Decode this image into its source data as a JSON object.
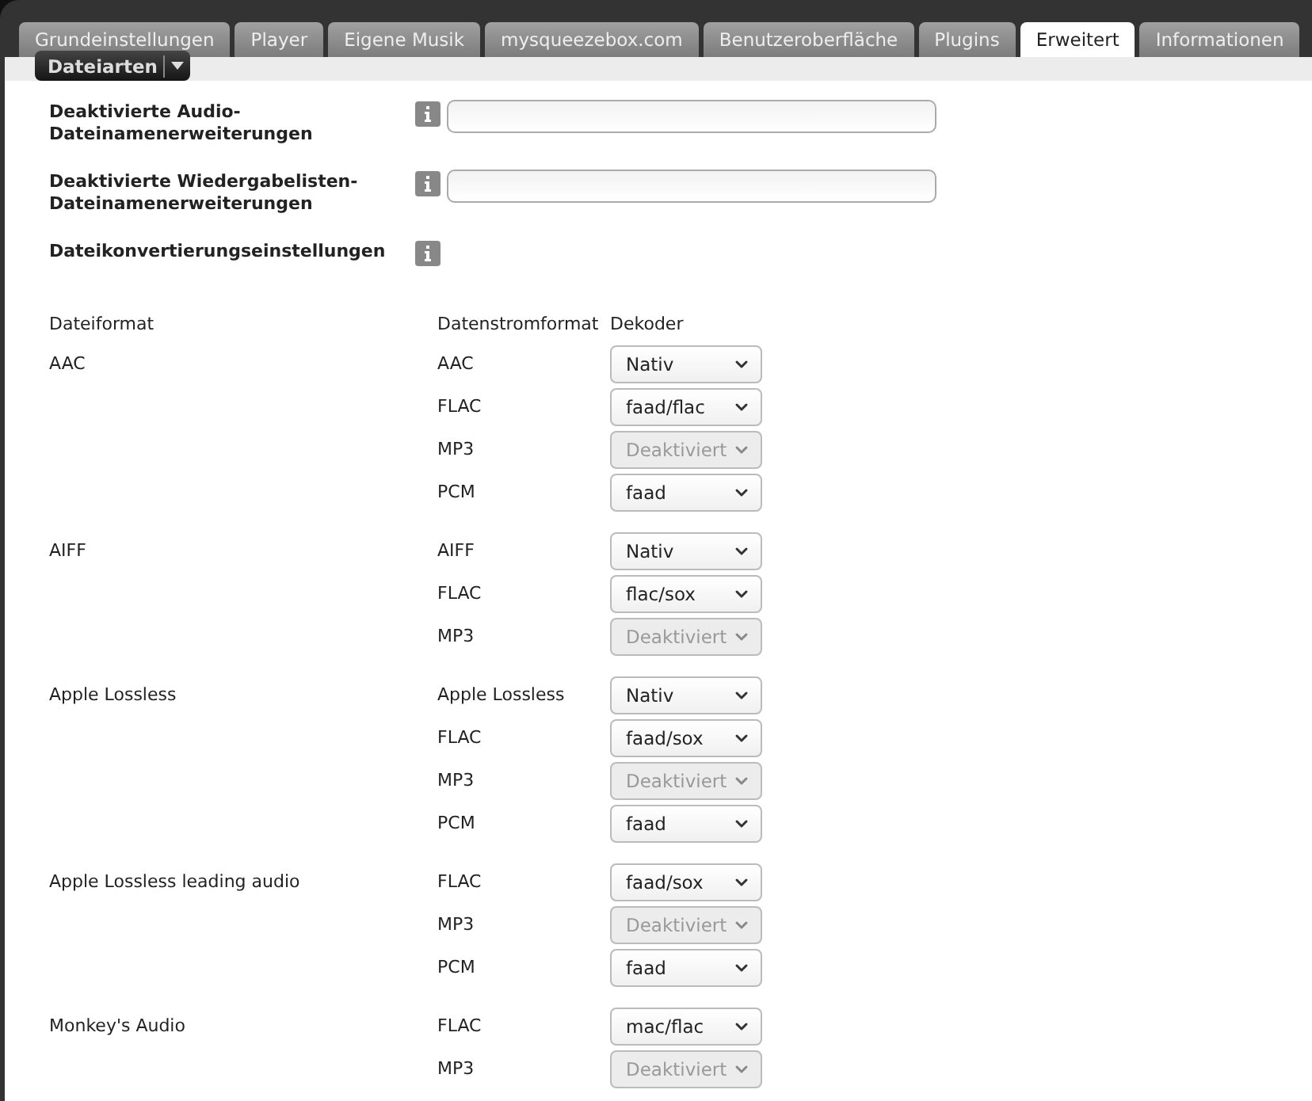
{
  "tabs": [
    {
      "label": "Grundeinstellungen",
      "selected": false
    },
    {
      "label": "Player",
      "selected": false
    },
    {
      "label": "Eigene Musik",
      "selected": false
    },
    {
      "label": "mysqueezebox.com",
      "selected": false
    },
    {
      "label": "Benutzeroberfläche",
      "selected": false
    },
    {
      "label": "Plugins",
      "selected": false
    },
    {
      "label": "Erweitert",
      "selected": true
    },
    {
      "label": "Informationen",
      "selected": false
    }
  ],
  "menu_button": {
    "label": "Dateiarten"
  },
  "settings": [
    {
      "label": "Deaktivierte Audio-Dateinamenerweiterungen",
      "kind": "field"
    },
    {
      "label": "Deaktivierte Wiedergabelisten-Dateinamenerweiterungen",
      "kind": "field"
    },
    {
      "label": "Dateikonvertierungseinstellungen",
      "kind": "heading"
    }
  ],
  "table": {
    "columns": [
      "Dateiformat",
      "Datenstromformat",
      "Dekoder"
    ],
    "groups": [
      {
        "format": "AAC",
        "streams": [
          {
            "format": "AAC",
            "decoder": "Nativ",
            "disabled": false
          },
          {
            "format": "FLAC",
            "decoder": "faad/flac",
            "disabled": false
          },
          {
            "format": "MP3",
            "decoder": "Deaktiviert",
            "disabled": true
          },
          {
            "format": "PCM",
            "decoder": "faad",
            "disabled": false
          }
        ]
      },
      {
        "format": "AIFF",
        "streams": [
          {
            "format": "AIFF",
            "decoder": "Nativ",
            "disabled": false
          },
          {
            "format": "FLAC",
            "decoder": "flac/sox",
            "disabled": false
          },
          {
            "format": "MP3",
            "decoder": "Deaktiviert",
            "disabled": true
          }
        ]
      },
      {
        "format": "Apple Lossless",
        "streams": [
          {
            "format": "Apple Lossless",
            "decoder": "Nativ",
            "disabled": false
          },
          {
            "format": "FLAC",
            "decoder": "faad/sox",
            "disabled": false
          },
          {
            "format": "MP3",
            "decoder": "Deaktiviert",
            "disabled": true
          },
          {
            "format": "PCM",
            "decoder": "faad",
            "disabled": false
          }
        ]
      },
      {
        "format": "Apple Lossless leading audio",
        "streams": [
          {
            "format": "FLAC",
            "decoder": "faad/sox",
            "disabled": false
          },
          {
            "format": "MP3",
            "decoder": "Deaktiviert",
            "disabled": true
          },
          {
            "format": "PCM",
            "decoder": "faad",
            "disabled": false
          }
        ]
      },
      {
        "format": "Monkey's Audio",
        "streams": [
          {
            "format": "FLAC",
            "decoder": "mac/flac",
            "disabled": false
          },
          {
            "format": "MP3",
            "decoder": "Deaktiviert",
            "disabled": true
          }
        ]
      }
    ]
  }
}
